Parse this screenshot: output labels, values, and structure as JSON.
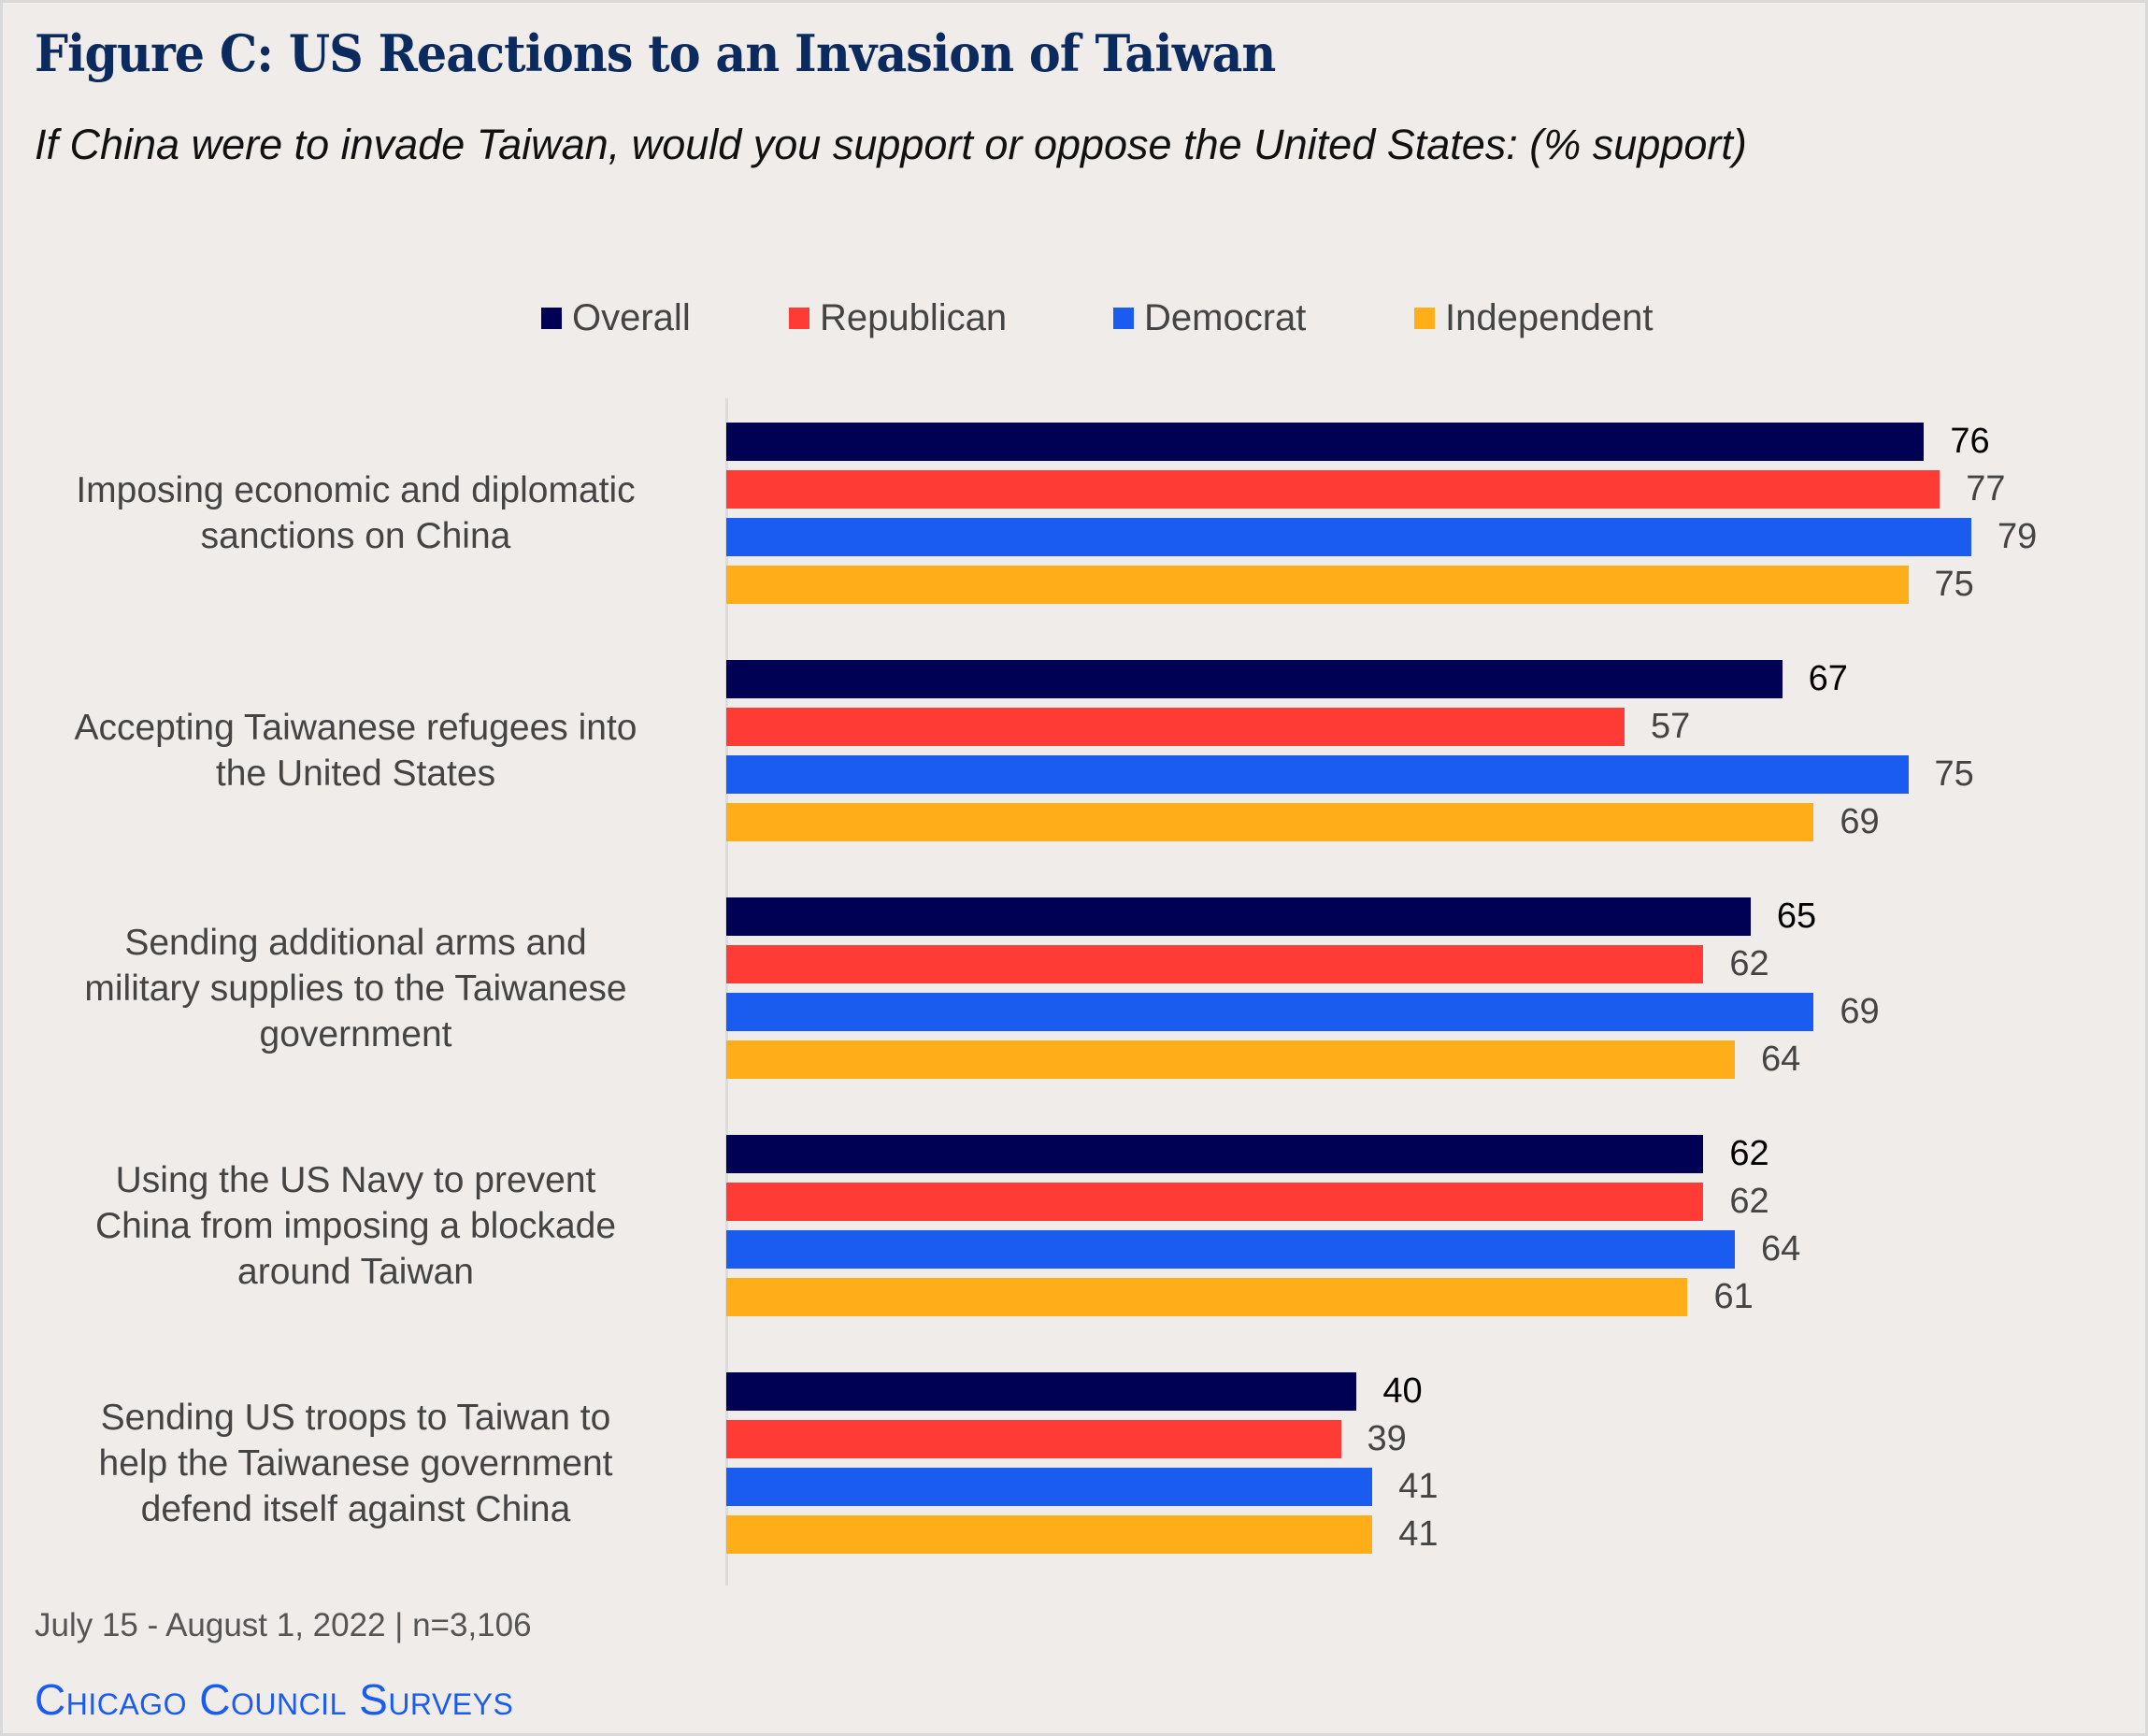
{
  "header": {
    "title": "Figure C: US Reactions to an Invasion of Taiwan",
    "subtitle": "If China were to invade Taiwan, would you support or oppose the United States: (% support)"
  },
  "footer": {
    "date_sample": "July 15 - August 1, 2022 | n=3,106",
    "brand": "Chicago Council Surveys",
    "brand_color": "#1a5cf0"
  },
  "chart_data": {
    "type": "bar",
    "orientation": "horizontal",
    "title": "Figure C: US Reactions to an Invasion of Taiwan",
    "subtitle": "If China were to invade Taiwan, would you support or oppose the United States: (% support)",
    "xlabel": "",
    "ylabel": "",
    "xlim": [
      0,
      100
    ],
    "grid": false,
    "legend_position": "top-center",
    "categories": [
      "Imposing economic and diplomatic sanctions on China",
      "Accepting Taiwanese refugees into the United States",
      "Sending additional arms and military supplies to the Taiwanese government",
      "Using the US Navy to prevent China from imposing a blockade around Taiwan",
      "Sending US troops to Taiwan to help the Taiwanese government defend itself against China"
    ],
    "category_lines": [
      [
        "Imposing economic and diplomatic",
        "sanctions on China"
      ],
      [
        "Accepting Taiwanese refugees into",
        "the United States"
      ],
      [
        "Sending additional arms and",
        "military supplies to the Taiwanese",
        "government"
      ],
      [
        "Using the US Navy to prevent",
        "China from imposing a blockade",
        "around Taiwan"
      ],
      [
        "Sending US troops to Taiwan to",
        "help the Taiwanese government",
        "defend itself against China"
      ]
    ],
    "series": [
      {
        "name": "Overall",
        "color": "#000055",
        "values": [
          76,
          67,
          65,
          62,
          40
        ]
      },
      {
        "name": "Republican",
        "color": "#ff3b36",
        "values": [
          77,
          57,
          62,
          62,
          39
        ]
      },
      {
        "name": "Democrat",
        "color": "#1a5cf0",
        "values": [
          79,
          75,
          69,
          64,
          41
        ]
      },
      {
        "name": "Independent",
        "color": "#ffad19",
        "values": [
          75,
          69,
          64,
          61,
          41
        ]
      }
    ]
  }
}
